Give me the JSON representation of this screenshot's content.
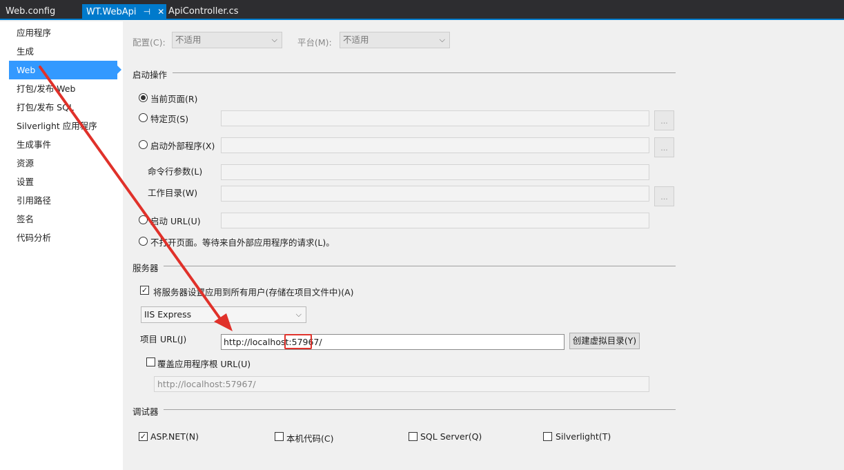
{
  "tabs": [
    {
      "label": "Web.config"
    },
    {
      "label": "WT.WebApi",
      "pin": "⊣",
      "close": "✕"
    },
    {
      "label": "ApiController.cs"
    }
  ],
  "nav": {
    "items": [
      {
        "label": "应用程序"
      },
      {
        "label": "生成"
      },
      {
        "label": "Web"
      },
      {
        "label": "打包/发布 Web"
      },
      {
        "label": "打包/发布 SQL"
      },
      {
        "label": "Silverlight 应用程序"
      },
      {
        "label": "生成事件"
      },
      {
        "label": "资源"
      },
      {
        "label": "设置"
      },
      {
        "label": "引用路径"
      },
      {
        "label": "签名"
      },
      {
        "label": "代码分析"
      }
    ]
  },
  "config": {
    "config_label": "配置(C):",
    "config_value": "不适用",
    "platform_label": "平台(M):",
    "platform_value": "不适用"
  },
  "start": {
    "title": "启动操作",
    "current_page": "当前页面(R)",
    "specific_page": "特定页(S)",
    "external_program": "启动外部程序(X)",
    "cmd_args": "命令行参数(L)",
    "work_dir": "工作目录(W)",
    "start_url": "启动 URL(U)",
    "dont_open": "不打开页面。等待来自外部应用程序的请求(L)。",
    "browse": "..."
  },
  "server": {
    "title": "服务器",
    "apply_all": "将服务器设置应用到所有用户(存储在项目文件中)(A)",
    "server_type": "IIS Express",
    "project_url_label": "项目 URL(J)",
    "project_url": "http://localhost:57967/",
    "create_vdir": "创建虚拟目录(Y)",
    "override_root": "覆盖应用程序根 URL(U)",
    "root_url": "http://localhost:57967/"
  },
  "debugger": {
    "title": "调试器",
    "aspnet": "ASP.NET(N)",
    "native": "本机代码(C)",
    "sqlserver": "SQL Server(Q)",
    "silverlight": "Silverlight(T)",
    "check_mark": "✓"
  },
  "colors": {
    "tab_bar": "#2d2d30",
    "accent": "#007acc",
    "nav_selected": "#3399ff",
    "annotation": "#e0312a"
  }
}
